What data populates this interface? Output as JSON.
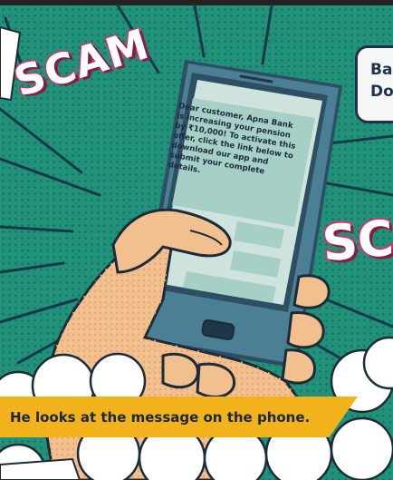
{
  "stamp_left": "SCAM",
  "stamp_right": "SC",
  "speech_bubble": {
    "line1": "Ba",
    "line2": "Do"
  },
  "phone": {
    "sms_message": "Dear customer, Apna Bank is increasing your pension by ₹10,000! To activate this offer, click the link below to download our app and submit your complete details."
  },
  "caption": "He looks at the message on the phone.",
  "colors": {
    "background": "#21917a",
    "stamp_pink": "#d6336c",
    "caption_yellow": "#f2b21c",
    "skin": "#f2c08f",
    "phone_body": "#4a7f94"
  }
}
